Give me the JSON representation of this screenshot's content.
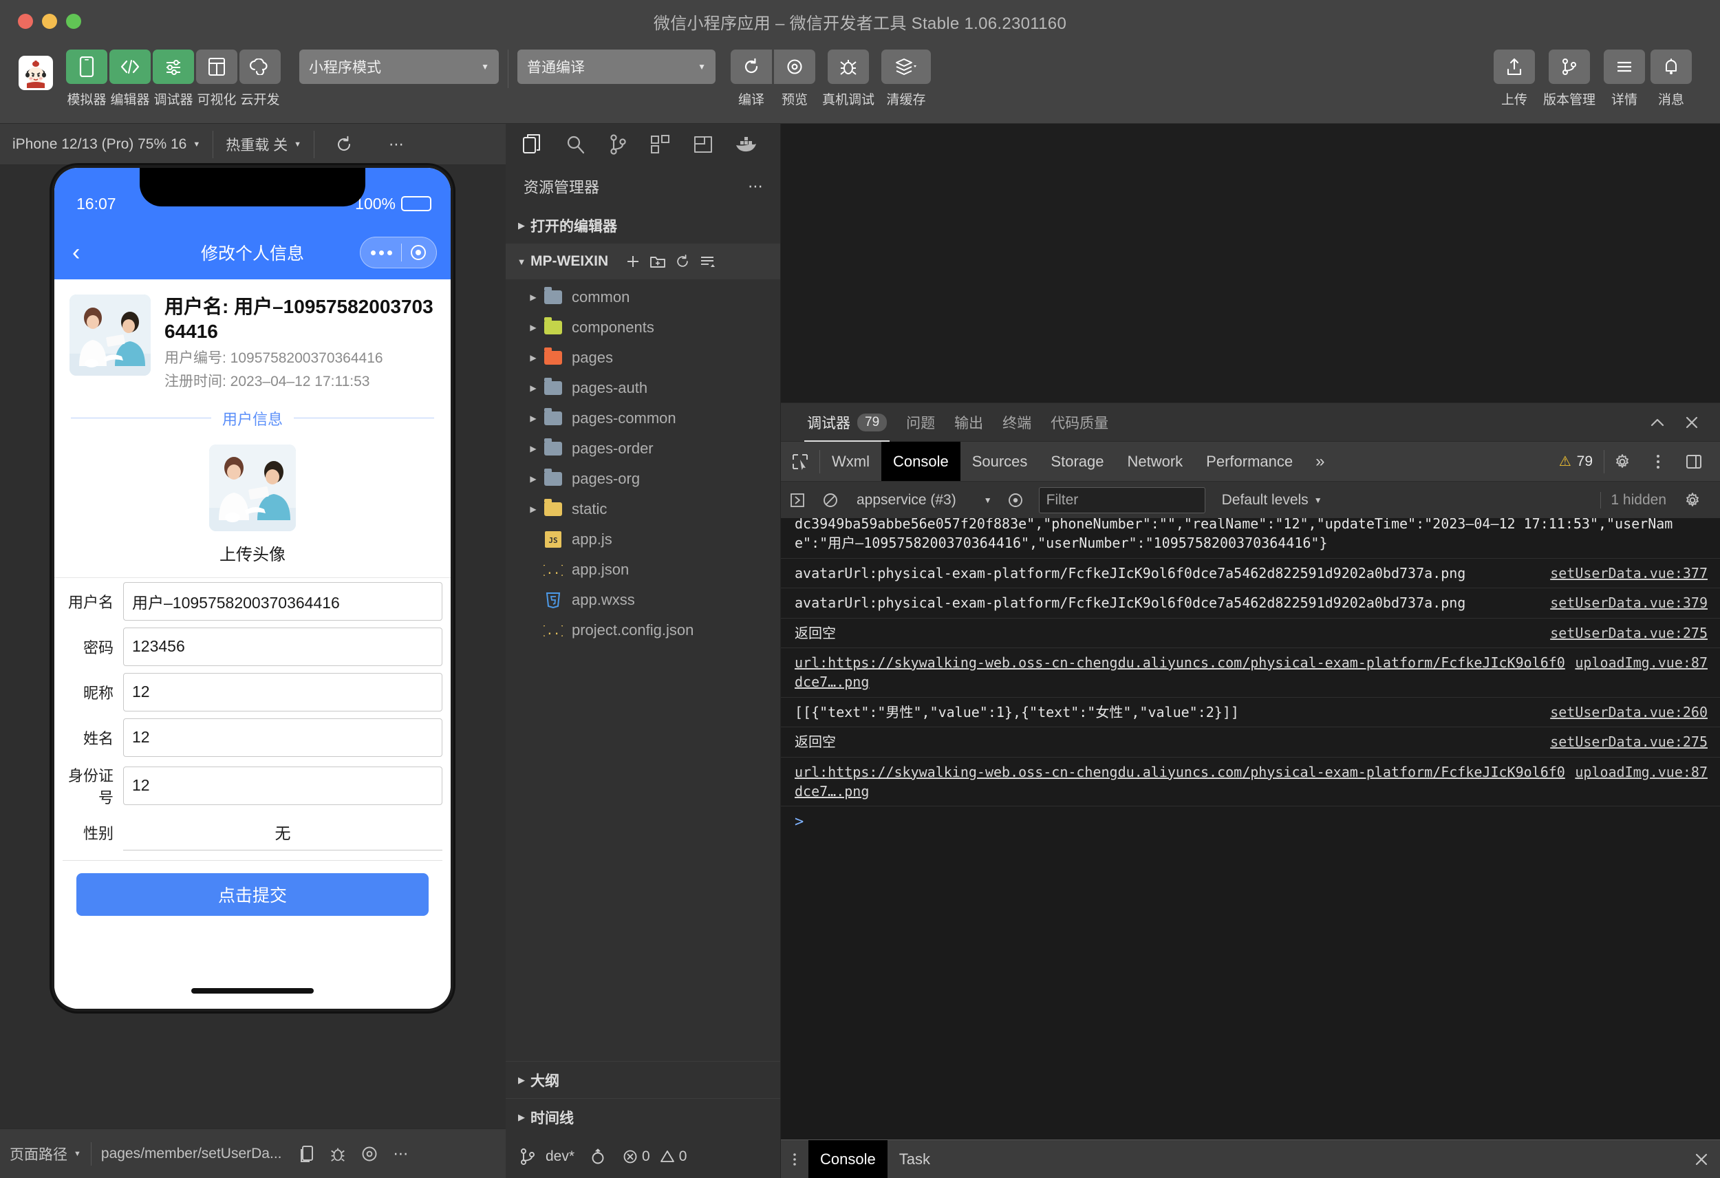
{
  "window": {
    "title": "微信小程序应用 – 微信开发者工具 Stable 1.06.2301160"
  },
  "toolbar": {
    "items": [
      {
        "label": "模拟器",
        "icon": "phone-simulator-icon",
        "active": true
      },
      {
        "label": "编辑器",
        "icon": "code-editor-icon",
        "active": true
      },
      {
        "label": "调试器",
        "icon": "debugger-sliders-icon",
        "active": true
      },
      {
        "label": "可视化",
        "icon": "visualization-grid-icon",
        "active": false
      },
      {
        "label": "云开发",
        "icon": "cloud-dev-icon",
        "active": false
      }
    ],
    "mode_select": "小程序模式",
    "compile_select": "普通编译",
    "actions": [
      {
        "label": "编译",
        "icon": "refresh-compile-icon"
      },
      {
        "label": "预览",
        "icon": "preview-eye-icon"
      },
      {
        "label": "真机调试",
        "icon": "bug-device-icon"
      },
      {
        "label": "清缓存",
        "icon": "layers-clear-cache-icon"
      }
    ],
    "right_actions": [
      {
        "label": "上传",
        "icon": "upload-icon"
      },
      {
        "label": "版本管理",
        "icon": "git-branch-icon"
      },
      {
        "label": "详情",
        "icon": "details-menu-icon"
      },
      {
        "label": "消息",
        "icon": "bell-notification-icon"
      }
    ]
  },
  "simulator": {
    "device": "iPhone 12/13 (Pro) 75% 16",
    "hot_reload": "热重载 关",
    "refresh_icon": "refresh-icon",
    "more_icon": "more-dots-icon",
    "phone": {
      "status_time": "16:07",
      "battery_pct": "100%",
      "nav_title": "修改个人信息",
      "back_icon": "chevron-left-icon",
      "profile": {
        "name_line": "用户名: 用户–1095758200370364416",
        "number_line": "用户编号: 1095758200370364416",
        "register_line": "注册时间: 2023–04–12 17:11:53"
      },
      "section_label": "用户信息",
      "upload_caption": "上传头像",
      "fields": [
        {
          "label": "用户名",
          "value": "用户–1095758200370364416"
        },
        {
          "label": "密码",
          "value": "123456"
        },
        {
          "label": "昵称",
          "value": "12"
        },
        {
          "label": "姓名",
          "value": "12"
        },
        {
          "label": "身份证号",
          "value": "12"
        }
      ],
      "picker": {
        "label": "性别",
        "value": "无"
      },
      "submit_label": "点击提交"
    },
    "status_bar": {
      "page_path_label": "页面路径",
      "page_path": "pages/member/setUserDa...",
      "icons": [
        "copy-icon",
        "bug-icon",
        "eye-icon",
        "more-dots-icon"
      ]
    }
  },
  "explorer": {
    "icon_bar": [
      {
        "name": "files-explorer-icon",
        "active": true
      },
      {
        "name": "search-icon",
        "active": false
      },
      {
        "name": "source-control-icon",
        "active": false
      },
      {
        "name": "extensions-icon",
        "active": false
      },
      {
        "name": "split-editor-icon",
        "active": false
      },
      {
        "name": "docker-icon",
        "active": false
      }
    ],
    "title": "资源管理器",
    "open_editors": "打开的编辑器",
    "project_name": "MP-WEIXIN",
    "project_actions": [
      "new-file-icon",
      "new-folder-icon",
      "refresh-icon",
      "collapse-all-icon"
    ],
    "tree": [
      {
        "name": "common",
        "type": "folder",
        "color": "#8a9bab",
        "expandable": true
      },
      {
        "name": "components",
        "type": "folder",
        "color": "#c4d44a",
        "expandable": true
      },
      {
        "name": "pages",
        "type": "folder",
        "color": "#ef6c3e",
        "expandable": true
      },
      {
        "name": "pages-auth",
        "type": "folder",
        "color": "#8a9bab",
        "expandable": true
      },
      {
        "name": "pages-common",
        "type": "folder",
        "color": "#8a9bab",
        "expandable": true
      },
      {
        "name": "pages-order",
        "type": "folder",
        "color": "#8a9bab",
        "expandable": true
      },
      {
        "name": "pages-org",
        "type": "folder",
        "color": "#8a9bab",
        "expandable": true
      },
      {
        "name": "static",
        "type": "folder",
        "color": "#e8c35c",
        "expandable": true
      },
      {
        "name": "app.js",
        "type": "js",
        "color": "#e8c35c",
        "expandable": false
      },
      {
        "name": "app.json",
        "type": "json",
        "color": "#e8c35c",
        "expandable": false
      },
      {
        "name": "app.wxss",
        "type": "css",
        "color": "#4d9ae8",
        "expandable": false
      },
      {
        "name": "project.config.json",
        "type": "json",
        "color": "#e8c35c",
        "expandable": false
      }
    ],
    "bottom_sections": [
      "大纲",
      "时间线"
    ],
    "git": {
      "branch": "dev*",
      "sync_icon": "sync-icon",
      "errors": "0",
      "warnings": "0"
    }
  },
  "devtools": {
    "panel_tabs": [
      {
        "label": "调试器",
        "badge": "79",
        "active": true
      },
      {
        "label": "问题",
        "badge": "",
        "active": false
      },
      {
        "label": "输出",
        "badge": "",
        "active": false
      },
      {
        "label": "终端",
        "badge": "",
        "active": false
      },
      {
        "label": "代码质量",
        "badge": "",
        "active": false
      }
    ],
    "panel_actions": [
      "chevron-up-icon",
      "close-icon"
    ],
    "inspector_tabs": [
      {
        "label": "Wxml",
        "active": false
      },
      {
        "label": "Console",
        "active": true
      },
      {
        "label": "Sources",
        "active": false
      },
      {
        "label": "Storage",
        "active": false
      },
      {
        "label": "Network",
        "active": false
      },
      {
        "label": "Performance",
        "active": false
      }
    ],
    "more_tabs_icon": "chevron-double-right-icon",
    "warning_count": "79",
    "right_icons": [
      "settings-gear-icon",
      "kebab-menu-icon",
      "dock-side-icon"
    ],
    "console_toolbar": {
      "execute_icon": "execute-icon",
      "clear_icon": "clear-console-icon",
      "context": "appservice (#3)",
      "eye_icon": "live-expression-icon",
      "filter_placeholder": "Filter",
      "levels": "Default levels",
      "hidden_text": "1 hidden",
      "settings_icon": "settings-gear-icon"
    },
    "console_lines": [
      {
        "msg": "dc3949ba59abbe56e057f20f883e\",\"phoneNumber\":\"\",\"realName\":\"12\",\"updateTime\":\"2023–04–12 17:11:53\",\"userName\":\"用户–1095758200370364416\",\"userNumber\":\"1095758200370364416\"}",
        "src": "",
        "partial": true
      },
      {
        "msg": "avatarUrl:physical-exam-platform/FcfkeJIcK9ol6f0dce7a5462d822591d9202a0bd737a.png",
        "src": "setUserData.vue:377",
        "partial": false
      },
      {
        "msg": "avatarUrl:physical-exam-platform/FcfkeJIcK9ol6f0dce7a5462d822591d9202a0bd737a.png",
        "src": "setUserData.vue:379",
        "partial": false
      },
      {
        "msg": "返回空",
        "src": "setUserData.vue:275",
        "partial": false
      },
      {
        "msg": "url:https://skywalking-web.oss-cn-chengdu.aliyuncs.com/physical-exam-platform/FcfkeJIcK9ol6f0dce7….png",
        "src": "uploadImg.vue:87",
        "partial": false,
        "link": true
      },
      {
        "msg": "[[{\"text\":\"男性\",\"value\":1},{\"text\":\"女性\",\"value\":2}]]",
        "src": "setUserData.vue:260",
        "partial": false
      },
      {
        "msg": "返回空",
        "src": "setUserData.vue:275",
        "partial": false
      },
      {
        "msg": "url:https://skywalking-web.oss-cn-chengdu.aliyuncs.com/physical-exam-platform/FcfkeJIcK9ol6f0dce7….png",
        "src": "uploadImg.vue:87",
        "partial": false,
        "link": true
      }
    ],
    "prompt_symbol": ">",
    "drawer_tabs": [
      {
        "label": "Console",
        "active": true
      },
      {
        "label": "Task",
        "active": false
      }
    ],
    "drawer_close_icon": "close-icon"
  },
  "colors": {
    "accent_blue": "#3b7cff",
    "button_blue": "#4a86f7",
    "green_active": "#4fa86a",
    "warning_yellow": "#f1c232"
  }
}
